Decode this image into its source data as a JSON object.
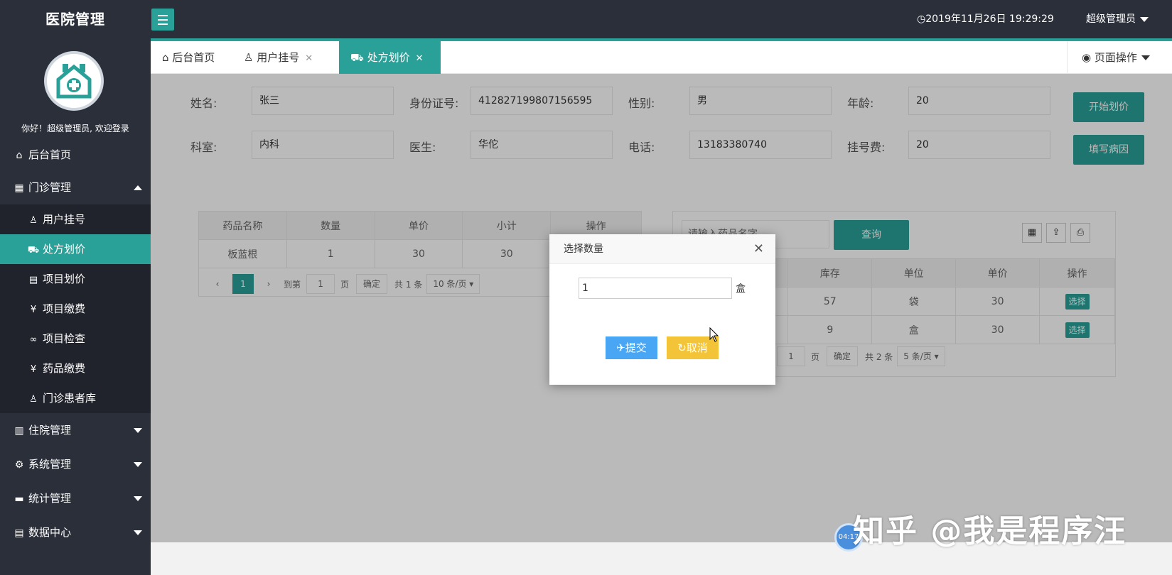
{
  "header": {
    "logo": "医院管理",
    "datetime": "2019年11月26日 19:29:29",
    "user_menu": "超级管理员"
  },
  "sidebar": {
    "welcome": "你好！超级管理员, 欢迎登录",
    "items": [
      {
        "label": "后台首页",
        "icon": "home-icon"
      },
      {
        "label": "门诊管理",
        "icon": "grid-icon",
        "expanded": true
      },
      {
        "label": "住院管理",
        "icon": "building-icon"
      },
      {
        "label": "系统管理",
        "icon": "gear-icon"
      },
      {
        "label": "统计管理",
        "icon": "monitor-icon"
      },
      {
        "label": "数据中心",
        "icon": "document-icon"
      }
    ],
    "sub_items": [
      {
        "label": "用户挂号",
        "icon": "user-icon"
      },
      {
        "label": "处方划价",
        "icon": "cart-icon",
        "active": true
      },
      {
        "label": "项目划价",
        "icon": "document-icon"
      },
      {
        "label": "项目缴费",
        "icon": "yen-icon"
      },
      {
        "label": "项目检查",
        "icon": "infinity-icon"
      },
      {
        "label": "药品缴费",
        "icon": "yen-icon"
      },
      {
        "label": "门诊患者库",
        "icon": "person-icon"
      }
    ]
  },
  "tabs": [
    {
      "label": "后台首页"
    },
    {
      "label": "用户挂号"
    },
    {
      "label": "处方划价",
      "active": true
    }
  ],
  "page_op": "页面操作",
  "patient": {
    "name_label": "姓名:",
    "name": "张三",
    "id_label": "身份证号:",
    "id": "412827199807156595",
    "gender_label": "性别:",
    "gender": "男",
    "age_label": "年龄:",
    "age": "20",
    "dept_label": "科室:",
    "dept": "内科",
    "doctor_label": "医生:",
    "doctor": "华佗",
    "phone_label": "电话:",
    "phone": "13183380740",
    "fee_label": "挂号费:",
    "fee": "20"
  },
  "actions": {
    "start_pricing": "开始划价",
    "fill_diagnosis": "填写病因"
  },
  "prescription_table": {
    "headers": [
      "药品名称",
      "数量",
      "单价",
      "小计",
      "操作"
    ],
    "rows": [
      [
        "板蓝根",
        "1",
        "30",
        "30"
      ]
    ],
    "pager": {
      "prev": "‹",
      "current": "1",
      "next": "›",
      "goto_label": "到第",
      "page_value": "1",
      "page_unit": "页",
      "confirm": "确定",
      "total": "共 1 条",
      "per_page": "10 条/页"
    }
  },
  "drug_search": {
    "placeholder": "请输入药品名字",
    "search_button": "查询",
    "headers": [
      "库存",
      "单位",
      "单价",
      "操作"
    ],
    "rows": [
      [
        "57",
        "袋",
        "30",
        "选择"
      ],
      [
        "9",
        "盒",
        "30",
        "选择"
      ]
    ],
    "pager": {
      "page_value": "1",
      "page_unit": "页",
      "confirm": "确定",
      "total": "共 2 条",
      "per_page": "5 条/页"
    }
  },
  "dialog": {
    "title": "选择数量",
    "quantity": "1",
    "unit": "盒",
    "submit": "提交",
    "cancel": "取消"
  },
  "watermark": {
    "text": "知乎 @我是程序汪",
    "badge": "04:17"
  },
  "colors": {
    "accent": "#2aa198",
    "topbar": "#2b2f3a",
    "submit": "#48a6f5",
    "cancel": "#f4c438"
  }
}
